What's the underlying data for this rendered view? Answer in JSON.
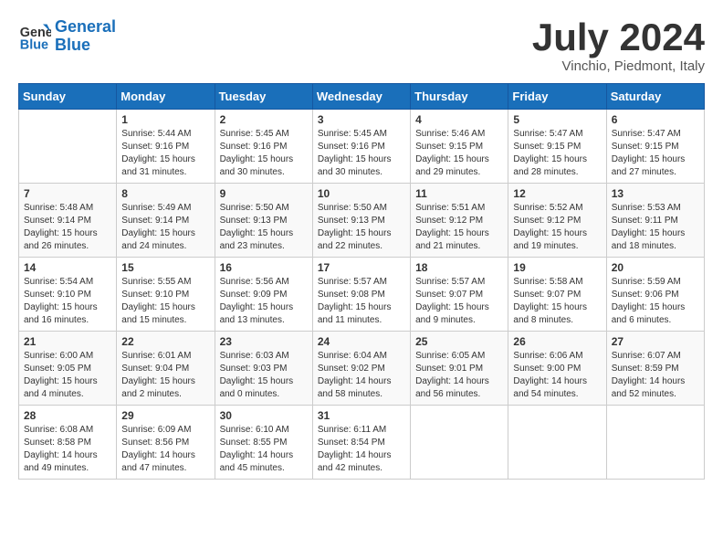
{
  "header": {
    "logo_line1": "General",
    "logo_line2": "Blue",
    "month_year": "July 2024",
    "location": "Vinchio, Piedmont, Italy"
  },
  "days_of_week": [
    "Sunday",
    "Monday",
    "Tuesday",
    "Wednesday",
    "Thursday",
    "Friday",
    "Saturday"
  ],
  "weeks": [
    [
      {
        "day": "",
        "info": ""
      },
      {
        "day": "1",
        "info": "Sunrise: 5:44 AM\nSunset: 9:16 PM\nDaylight: 15 hours\nand 31 minutes."
      },
      {
        "day": "2",
        "info": "Sunrise: 5:45 AM\nSunset: 9:16 PM\nDaylight: 15 hours\nand 30 minutes."
      },
      {
        "day": "3",
        "info": "Sunrise: 5:45 AM\nSunset: 9:16 PM\nDaylight: 15 hours\nand 30 minutes."
      },
      {
        "day": "4",
        "info": "Sunrise: 5:46 AM\nSunset: 9:15 PM\nDaylight: 15 hours\nand 29 minutes."
      },
      {
        "day": "5",
        "info": "Sunrise: 5:47 AM\nSunset: 9:15 PM\nDaylight: 15 hours\nand 28 minutes."
      },
      {
        "day": "6",
        "info": "Sunrise: 5:47 AM\nSunset: 9:15 PM\nDaylight: 15 hours\nand 27 minutes."
      }
    ],
    [
      {
        "day": "7",
        "info": "Sunrise: 5:48 AM\nSunset: 9:14 PM\nDaylight: 15 hours\nand 26 minutes."
      },
      {
        "day": "8",
        "info": "Sunrise: 5:49 AM\nSunset: 9:14 PM\nDaylight: 15 hours\nand 24 minutes."
      },
      {
        "day": "9",
        "info": "Sunrise: 5:50 AM\nSunset: 9:13 PM\nDaylight: 15 hours\nand 23 minutes."
      },
      {
        "day": "10",
        "info": "Sunrise: 5:50 AM\nSunset: 9:13 PM\nDaylight: 15 hours\nand 22 minutes."
      },
      {
        "day": "11",
        "info": "Sunrise: 5:51 AM\nSunset: 9:12 PM\nDaylight: 15 hours\nand 21 minutes."
      },
      {
        "day": "12",
        "info": "Sunrise: 5:52 AM\nSunset: 9:12 PM\nDaylight: 15 hours\nand 19 minutes."
      },
      {
        "day": "13",
        "info": "Sunrise: 5:53 AM\nSunset: 9:11 PM\nDaylight: 15 hours\nand 18 minutes."
      }
    ],
    [
      {
        "day": "14",
        "info": "Sunrise: 5:54 AM\nSunset: 9:10 PM\nDaylight: 15 hours\nand 16 minutes."
      },
      {
        "day": "15",
        "info": "Sunrise: 5:55 AM\nSunset: 9:10 PM\nDaylight: 15 hours\nand 15 minutes."
      },
      {
        "day": "16",
        "info": "Sunrise: 5:56 AM\nSunset: 9:09 PM\nDaylight: 15 hours\nand 13 minutes."
      },
      {
        "day": "17",
        "info": "Sunrise: 5:57 AM\nSunset: 9:08 PM\nDaylight: 15 hours\nand 11 minutes."
      },
      {
        "day": "18",
        "info": "Sunrise: 5:57 AM\nSunset: 9:07 PM\nDaylight: 15 hours\nand 9 minutes."
      },
      {
        "day": "19",
        "info": "Sunrise: 5:58 AM\nSunset: 9:07 PM\nDaylight: 15 hours\nand 8 minutes."
      },
      {
        "day": "20",
        "info": "Sunrise: 5:59 AM\nSunset: 9:06 PM\nDaylight: 15 hours\nand 6 minutes."
      }
    ],
    [
      {
        "day": "21",
        "info": "Sunrise: 6:00 AM\nSunset: 9:05 PM\nDaylight: 15 hours\nand 4 minutes."
      },
      {
        "day": "22",
        "info": "Sunrise: 6:01 AM\nSunset: 9:04 PM\nDaylight: 15 hours\nand 2 minutes."
      },
      {
        "day": "23",
        "info": "Sunrise: 6:03 AM\nSunset: 9:03 PM\nDaylight: 15 hours\nand 0 minutes."
      },
      {
        "day": "24",
        "info": "Sunrise: 6:04 AM\nSunset: 9:02 PM\nDaylight: 14 hours\nand 58 minutes."
      },
      {
        "day": "25",
        "info": "Sunrise: 6:05 AM\nSunset: 9:01 PM\nDaylight: 14 hours\nand 56 minutes."
      },
      {
        "day": "26",
        "info": "Sunrise: 6:06 AM\nSunset: 9:00 PM\nDaylight: 14 hours\nand 54 minutes."
      },
      {
        "day": "27",
        "info": "Sunrise: 6:07 AM\nSunset: 8:59 PM\nDaylight: 14 hours\nand 52 minutes."
      }
    ],
    [
      {
        "day": "28",
        "info": "Sunrise: 6:08 AM\nSunset: 8:58 PM\nDaylight: 14 hours\nand 49 minutes."
      },
      {
        "day": "29",
        "info": "Sunrise: 6:09 AM\nSunset: 8:56 PM\nDaylight: 14 hours\nand 47 minutes."
      },
      {
        "day": "30",
        "info": "Sunrise: 6:10 AM\nSunset: 8:55 PM\nDaylight: 14 hours\nand 45 minutes."
      },
      {
        "day": "31",
        "info": "Sunrise: 6:11 AM\nSunset: 8:54 PM\nDaylight: 14 hours\nand 42 minutes."
      },
      {
        "day": "",
        "info": ""
      },
      {
        "day": "",
        "info": ""
      },
      {
        "day": "",
        "info": ""
      }
    ]
  ]
}
